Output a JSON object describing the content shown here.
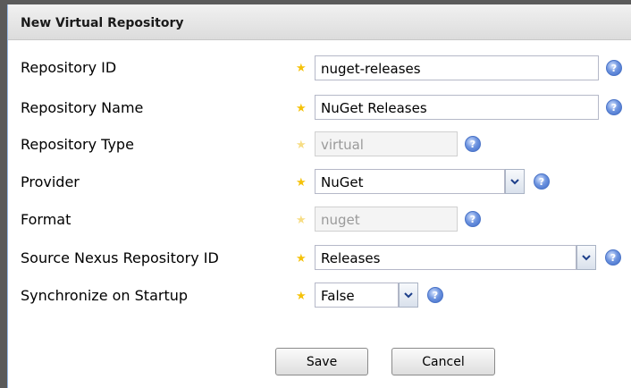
{
  "panel": {
    "title": "New Virtual Repository"
  },
  "fields": {
    "repository_id": {
      "label": "Repository ID",
      "value": "nuget-releases"
    },
    "repository_name": {
      "label": "Repository Name",
      "value": "NuGet Releases"
    },
    "repository_type": {
      "label": "Repository Type",
      "value": "virtual"
    },
    "provider": {
      "label": "Provider",
      "value": "NuGet"
    },
    "format": {
      "label": "Format",
      "value": "nuget"
    },
    "source_repository": {
      "label": "Source Nexus Repository ID",
      "value": "Releases"
    },
    "synchronize": {
      "label": "Synchronize on Startup",
      "value": "False"
    }
  },
  "buttons": {
    "save": "Save",
    "cancel": "Cancel"
  },
  "icons": {
    "required": "star-icon",
    "help": "help-icon",
    "dropdown": "chevron-down-icon"
  },
  "colors": {
    "required_star": "#f5c20a",
    "help_icon": "#4a78d4",
    "header_bg": "#e6e6e6"
  }
}
